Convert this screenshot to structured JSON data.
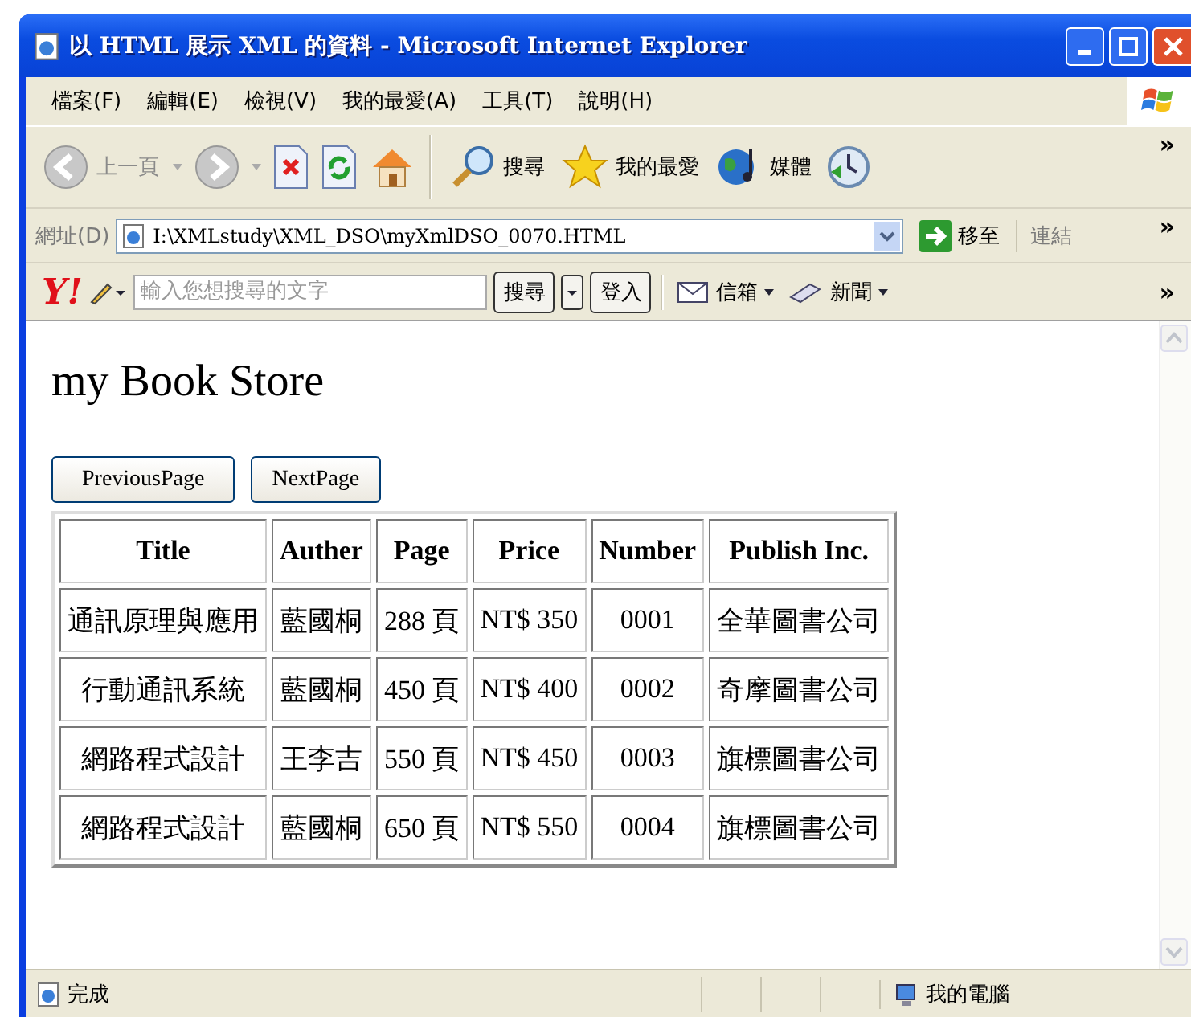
{
  "window": {
    "title": "以 HTML 展示 XML 的資料 - Microsoft Internet Explorer"
  },
  "menu": [
    "檔案(F)",
    "編輯(E)",
    "檢視(V)",
    "我的最愛(A)",
    "工具(T)",
    "說明(H)"
  ],
  "toolbar": {
    "back": "上一頁",
    "buttons": [
      {
        "kind": "search",
        "label": "搜尋"
      },
      {
        "kind": "favorites",
        "label": "我的最愛"
      },
      {
        "kind": "media",
        "label": "媒體"
      }
    ],
    "chevron": "»"
  },
  "address": {
    "label": "網址(D)",
    "value": "I:\\XMLstudy\\XML_DSO\\myXmlDSO_0070.HTML",
    "go": "移至",
    "links": "連結",
    "chevron": "»"
  },
  "yahoo": {
    "logo": "Y!",
    "placeholder": "輸入您想搜尋的文字",
    "search": "搜尋",
    "login": "登入",
    "mail": "信箱",
    "news": "新聞",
    "chevron": "»"
  },
  "page": {
    "heading": "my Book Store",
    "buttons": [
      "PreviousPage",
      "NextPage"
    ],
    "table": {
      "columns": [
        "Title",
        "Auther",
        "Page",
        "Price",
        "Number",
        "Publish Inc."
      ],
      "rows": [
        [
          "通訊原理與應用",
          "藍國桐",
          "288 頁",
          "NT$ 350",
          "0001",
          "全華圖書公司"
        ],
        [
          "行動通訊系統",
          "藍國桐",
          "450 頁",
          "NT$ 400",
          "0002",
          "奇摩圖書公司"
        ],
        [
          "網路程式設計",
          "王李吉",
          "550 頁",
          "NT$ 450",
          "0003",
          "旗標圖書公司"
        ],
        [
          "網路程式設計",
          "藍國桐",
          "650 頁",
          "NT$ 550",
          "0004",
          "旗標圖書公司"
        ]
      ]
    }
  },
  "status_bar": {
    "text": "完成",
    "zone": "我的電腦"
  }
}
